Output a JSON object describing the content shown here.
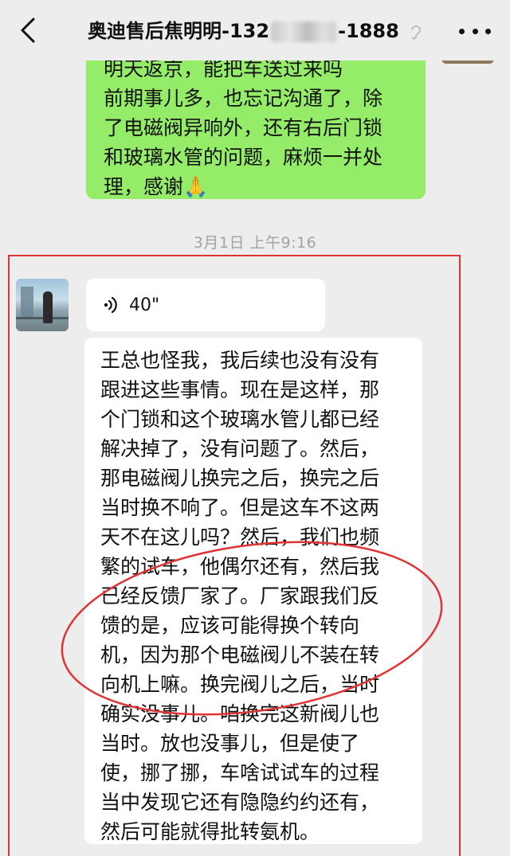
{
  "header": {
    "back_icon": "chevron-left-icon",
    "title_prefix": "奥迪售后焦明明-132",
    "title_suffix": "-1888",
    "ear_icon": "ear-icon",
    "more_icon": "more-dots-icon"
  },
  "messages": {
    "outgoing": {
      "lines": [
        "明天返京，能把车送过来吗",
        "前期事儿多，也忘记沟通了，除",
        "了电磁阀异响外，还有右后门锁",
        "和玻璃水管的问题，麻烦一并处",
        "理，感谢🙏"
      ]
    },
    "timestamp": "3月1日 上午9:16",
    "voice": {
      "duration": "40\"",
      "icon": "voice-waves-icon"
    },
    "incoming_text": {
      "lines": [
        "王总也怪我，我后续也没有没有",
        "跟进这些事情。现在是这样，那",
        "个门锁和这个玻璃水管儿都已经",
        "解决掉了，没有问题了。然后，",
        "那电磁阀儿换完之后，换完之后",
        "当时换不响了。但是这车不这两",
        "天不在这儿吗？然后，我们也频",
        "繁的试车，他偶尔还有，然后我",
        "已经反馈厂家了。厂家跟我们反",
        "馈的是，应该可能得换个转向",
        "机，因为那个电磁阀儿不装在转",
        "向机上嘛。换完阀儿之后，当时",
        "确实没事儿。咱换完这新阀儿也",
        "当时。放也没事儿，但是使了",
        "使，挪了挪，车啥试试车的过程",
        "当中发现它还有隐隐约约还有，",
        "然后可能就得批转氨机。"
      ]
    }
  },
  "annotation": {
    "color": "#e03434"
  },
  "colors": {
    "background": "#ededed",
    "outgoing_bubble": "#95ec69",
    "incoming_bubble": "#ffffff",
    "timestamp_text": "#a3a3a3"
  }
}
